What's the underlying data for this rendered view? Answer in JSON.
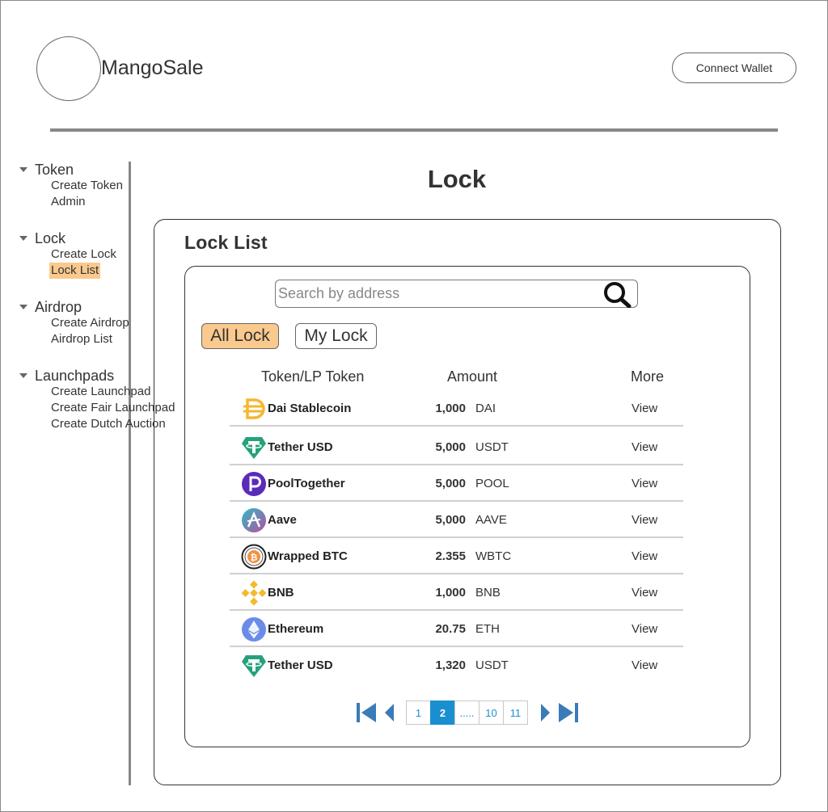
{
  "header": {
    "brand": "MangoSale",
    "connect_label": "Connect Wallet"
  },
  "sidebar": {
    "groups": [
      {
        "title": "Token",
        "items": [
          {
            "label": "Create Token"
          },
          {
            "label": "Admin"
          }
        ]
      },
      {
        "title": "Lock",
        "items": [
          {
            "label": "Create Lock"
          },
          {
            "label": "Lock List",
            "active": true
          }
        ]
      },
      {
        "title": "Airdrop",
        "items": [
          {
            "label": "Create Airdrop"
          },
          {
            "label": "Airdrop List"
          }
        ]
      },
      {
        "title": "Launchpads",
        "items": [
          {
            "label": "Create Launchpad"
          },
          {
            "label": "Create Fair Launchpad"
          },
          {
            "label": "Create Dutch Auction"
          }
        ]
      }
    ]
  },
  "main": {
    "page_title": "Lock",
    "card_title": "Lock List",
    "search": {
      "placeholder": "Search by address",
      "value": ""
    },
    "tabs": [
      {
        "label": "All Lock",
        "active": true
      },
      {
        "label": "My Lock",
        "active": false
      }
    ],
    "columns": {
      "token": "Token/LP Token",
      "amount": "Amount",
      "more": "More"
    },
    "rows": [
      {
        "name": "Dai Stablecoin",
        "amount": "1,000",
        "symbol": "DAI",
        "more": "View",
        "icon": "dai-icon"
      },
      {
        "name": "Tether USD",
        "amount": "5,000",
        "symbol": "USDT",
        "more": "View",
        "icon": "tether-icon"
      },
      {
        "name": "PoolTogether",
        "amount": "5,000",
        "symbol": "POOL",
        "more": "View",
        "icon": "pooltogether-icon"
      },
      {
        "name": "Aave",
        "amount": "5,000",
        "symbol": "AAVE",
        "more": "View",
        "icon": "aave-icon"
      },
      {
        "name": "Wrapped BTC",
        "amount": "2.355",
        "symbol": "WBTC",
        "more": "View",
        "icon": "wbtc-icon"
      },
      {
        "name": "BNB",
        "amount": "1,000",
        "symbol": "BNB",
        "more": "View",
        "icon": "bnb-icon"
      },
      {
        "name": "Ethereum",
        "amount": "20.75",
        "symbol": "ETH",
        "more": "View",
        "icon": "ethereum-icon"
      },
      {
        "name": "Tether USD",
        "amount": "1,320",
        "symbol": "USDT",
        "more": "View",
        "icon": "tether-icon"
      }
    ],
    "pagination": {
      "pages": [
        "1",
        "2",
        ".....",
        "10",
        "11"
      ],
      "current": "2"
    }
  },
  "colors": {
    "accent_orange": "#f9c98d",
    "pager_blue": "#1a8fd0",
    "nav_arrow_blue": "#3a7bb8"
  }
}
